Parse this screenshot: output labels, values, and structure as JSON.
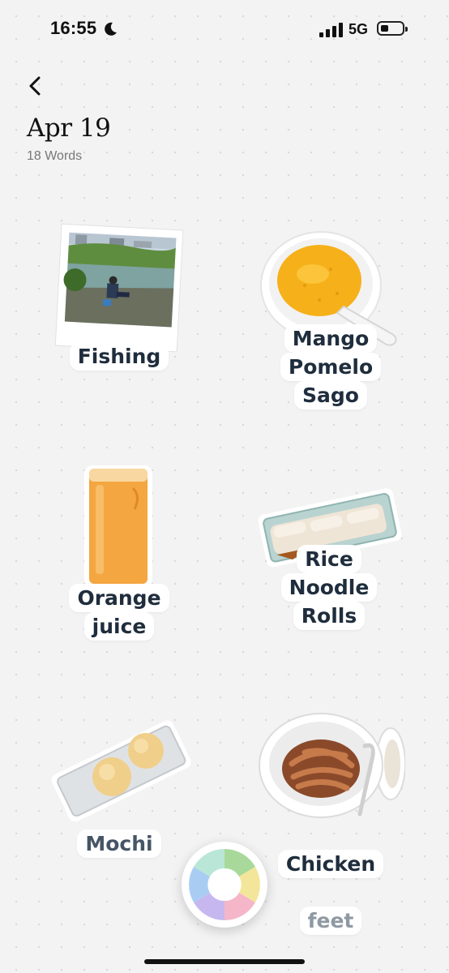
{
  "status_bar": {
    "time": "16:55",
    "network": "5G"
  },
  "header": {
    "date": "Apr 19",
    "word_count": "18 Words"
  },
  "stickers": [
    {
      "label": "Fishing"
    },
    {
      "label": "Mango\nPomelo\nSago"
    },
    {
      "label": "Orange\njuice"
    },
    {
      "label": "Rice\nNoodle\nRolls"
    },
    {
      "label": "Mochi"
    },
    {
      "label": "Chicken\nfeet"
    }
  ],
  "icons": [
    "moon-icon",
    "signal-icon",
    "battery-icon",
    "back-chevron-icon",
    "camera-aperture-icon"
  ],
  "colors": {
    "label_text": "#1f2d3d",
    "background": "#f3f3f4"
  }
}
